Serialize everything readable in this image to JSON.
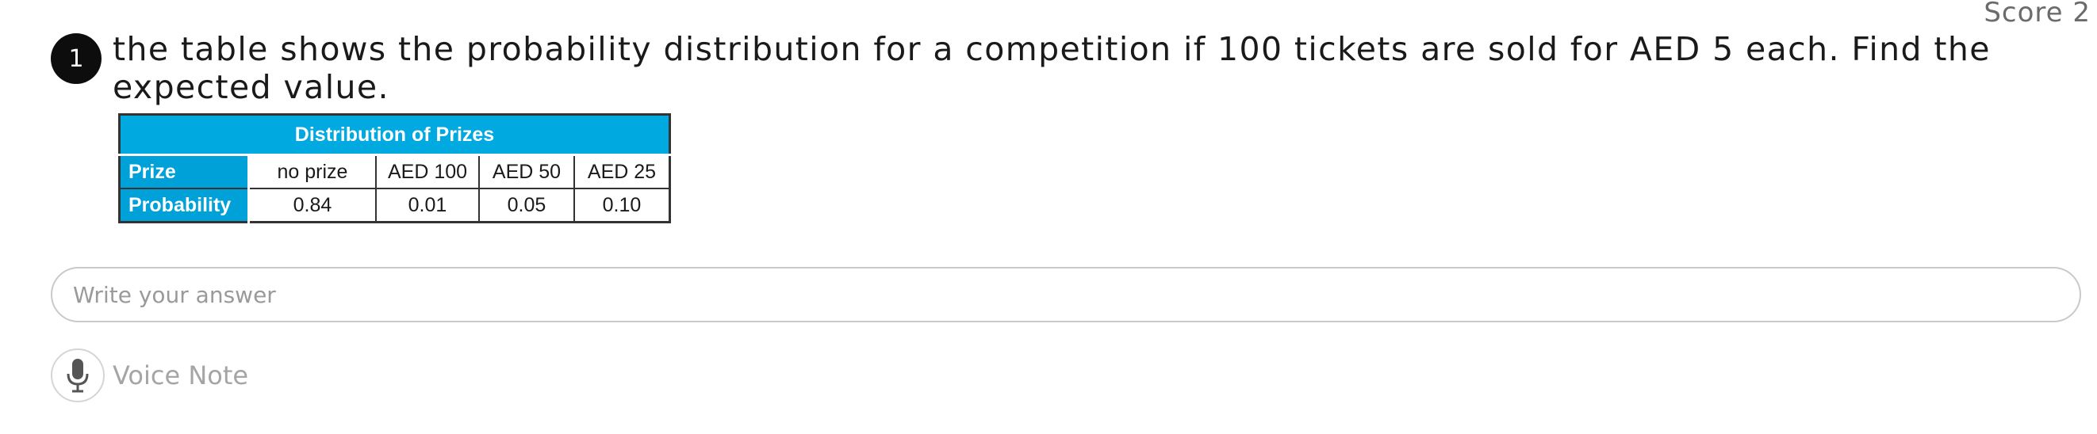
{
  "score": {
    "label": "Score 2"
  },
  "question": {
    "number": "1",
    "text": "the table shows the probability distribution for a competition if 100 tickets are sold for AED 5 each. Find the expected value."
  },
  "table": {
    "caption": "Distribution of Prizes",
    "rows": [
      {
        "header": "Prize",
        "cells": [
          "no prize",
          "AED 100",
          "AED 50",
          "AED 25"
        ]
      },
      {
        "header": "Probability",
        "cells": [
          "0.84",
          "0.01",
          "0.05",
          "0.10"
        ]
      }
    ],
    "header_color": "#00a9e0"
  },
  "answer": {
    "placeholder": "Write your answer"
  },
  "voice_note": {
    "label": "Voice Note",
    "icon": "microphone-icon"
  }
}
